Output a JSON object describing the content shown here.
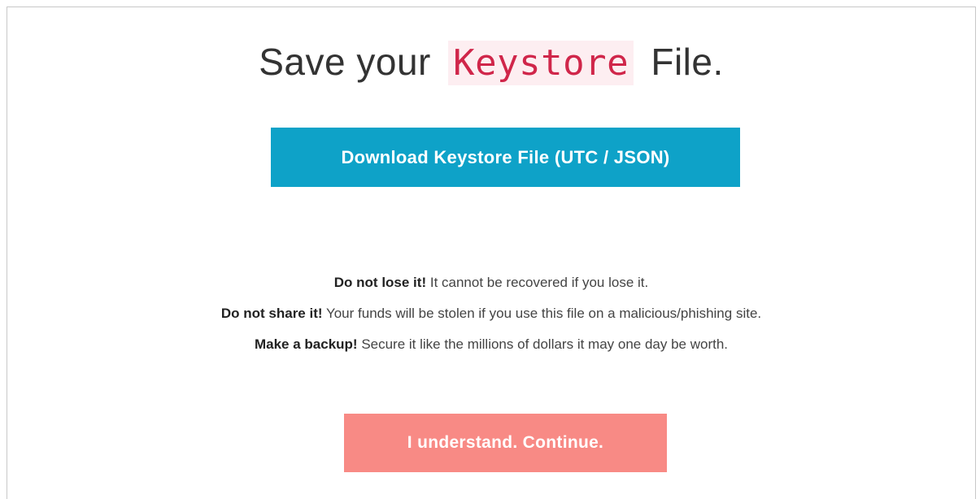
{
  "title": {
    "prefix": "Save your",
    "highlight": "Keystore",
    "suffix": "File."
  },
  "download_button": {
    "label": "Download Keystore File (UTC / JSON)"
  },
  "warnings": [
    {
      "strong": "Do not lose it!",
      "text": "It cannot be recovered if you lose it."
    },
    {
      "strong": "Do not share it!",
      "text": "Your funds will be stolen if you use this file on a malicious/phishing site."
    },
    {
      "strong": "Make a backup!",
      "text": "Secure it like the millions of dollars it may one day be worth."
    }
  ],
  "continue_button": {
    "label": "I understand. Continue."
  },
  "colors": {
    "primary": "#0ea2c8",
    "danger": "#f88a85",
    "code_text": "#d0264a",
    "code_bg": "#fdeef1"
  }
}
